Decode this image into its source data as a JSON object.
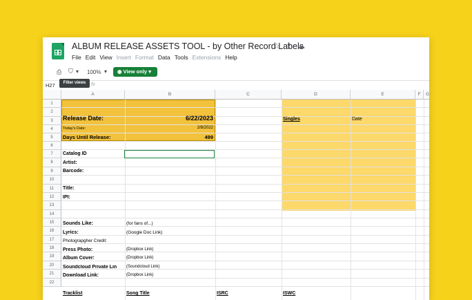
{
  "doc": {
    "title": "ALBUM RELEASE ASSETS TOOL - by Other Record Labels",
    "menu": [
      {
        "label": "File",
        "disabled": false
      },
      {
        "label": "Edit",
        "disabled": false
      },
      {
        "label": "View",
        "disabled": false
      },
      {
        "label": "Insert",
        "disabled": true
      },
      {
        "label": "Format",
        "disabled": true
      },
      {
        "label": "Data",
        "disabled": false
      },
      {
        "label": "Tools",
        "disabled": false
      },
      {
        "label": "Extensions",
        "disabled": true
      },
      {
        "label": "Help",
        "disabled": false
      }
    ]
  },
  "toolbar": {
    "zoom": "100%",
    "view_only": "View only",
    "tooltip": "Filter views"
  },
  "formula_bar": {
    "name_box": "H27",
    "fx": "fx"
  },
  "columns": [
    "A",
    "B",
    "C",
    "D",
    "E",
    "F",
    "G"
  ],
  "rows": [
    "1",
    "2",
    "3",
    "4",
    "5",
    "6",
    "7",
    "8",
    "9",
    "10",
    "11",
    "12",
    "13",
    "14",
    "15",
    "16",
    "17",
    "18",
    "19",
    "20",
    "21",
    "22"
  ],
  "cells": {
    "release_date_label": "Release Date:",
    "release_date_value": "6/22/2023",
    "todays_date_label": "Today's Date:",
    "todays_date_value": "2/8/2022",
    "days_until_label": "Days Until Release:",
    "days_until_value": "499",
    "singles": "Singles",
    "date": "Date",
    "catalog_id": "Catalog ID",
    "artist": "Artist:",
    "barcode": "Barcode:",
    "title": "Title:",
    "ipi": "IPI:",
    "sounds_like": "Sounds Like:",
    "sounds_like_val": "(for fans of...)",
    "lyrics": "Lyrics:",
    "lyrics_val": "(Google Doc Link)",
    "photographer": "Photograpgher Credit:",
    "press_photo": "Press Photo:",
    "press_photo_val": "(Dropbox Link)",
    "album_cover": "Album Cover:",
    "album_cover_val": "(Dropbox Link)",
    "soundcloud": "Soundcloud Private Lin",
    "soundcloud_val": "(Soundcloud Link)",
    "download_link": "Download Link:",
    "download_link_val": "(Dropbox Link)",
    "tracklist": "Tracklist",
    "song_title": "Song Title",
    "isrc": "ISRC",
    "iswc": "ISWC"
  },
  "colors": {
    "background": "#f7d21b",
    "gold_header": "#f2c23c",
    "light_gold": "#fdd86a",
    "selection": "#188038"
  }
}
